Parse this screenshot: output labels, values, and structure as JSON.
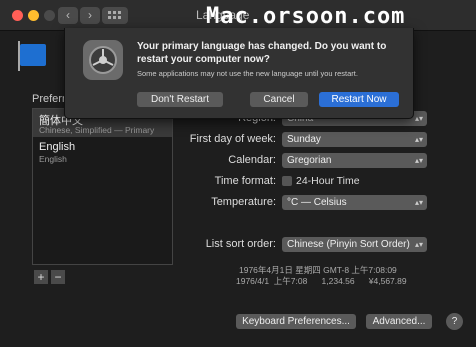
{
  "window": {
    "title": "Language",
    "watermark": "Mac.orsoon.com"
  },
  "preferred_languages_label": "Preferred languages:",
  "languages": [
    {
      "name": "簡体中文",
      "detail": "Chinese, Simplified — Primary"
    },
    {
      "name": "English",
      "detail": "English"
    }
  ],
  "list_buttons": {
    "add": "+",
    "remove": "−"
  },
  "settings": {
    "region": {
      "label": "Region:",
      "value": "China"
    },
    "first_day": {
      "label": "First day of week:",
      "value": "Sunday"
    },
    "calendar": {
      "label": "Calendar:",
      "value": "Gregorian"
    },
    "time_format": {
      "label": "Time format:",
      "checkbox_label": "24-Hour Time"
    },
    "temperature": {
      "label": "Temperature:",
      "value": "°C — Celsius"
    },
    "sort_order": {
      "label": "List sort order:",
      "value": "Chinese (Pinyin Sort Order)"
    }
  },
  "samples": {
    "line1": "1976年4月1日 星期四 GMT-8 上午7:08:09",
    "line2": "1976/4/1  上午7:08      1,234.56      ¥4,567.89"
  },
  "bottom_buttons": {
    "keyboard": "Keyboard Preferences...",
    "advanced": "Advanced...",
    "help": "?"
  },
  "dialog": {
    "title": "Your primary language has changed. Do you want to restart your computer now?",
    "message": "Some applications may not use the new language until you restart.",
    "dont_restart": "Don't Restart",
    "cancel": "Cancel",
    "restart_now": "Restart Now"
  },
  "colors": {
    "accent": "#2b6fd6",
    "window_bg": "#1e1e1e",
    "dialog_bg": "#323232"
  }
}
